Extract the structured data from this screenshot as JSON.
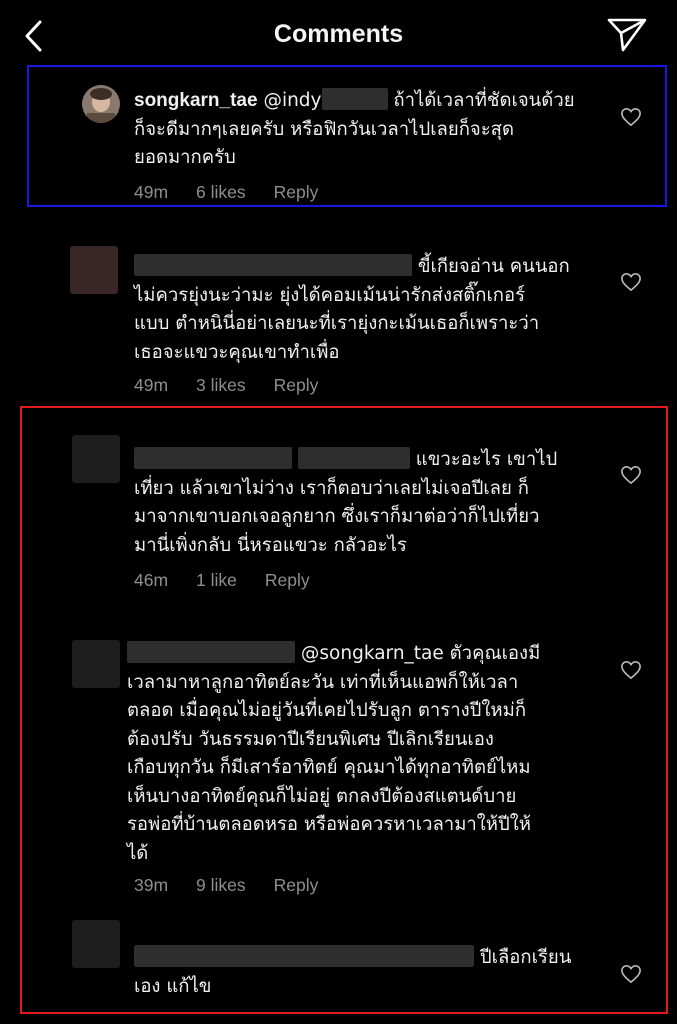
{
  "header": {
    "title": "Comments",
    "back_icon": "chevron-left-icon",
    "send_icon": "send-paper-plane-icon"
  },
  "comments": [
    {
      "username": "songkarn_tae",
      "mention": "@indy",
      "lines": [
        "ถ้าได้เวลาที่ชัดเจนด้วย",
        "ก็จะดีมากๆเลยครับ หรือฟิกวันเวลาไปเลยก็จะสุด",
        "ยอดมากครับ"
      ],
      "time": "49m",
      "likes": "6 likes",
      "reply": "Reply"
    },
    {
      "lines": [
        "ขี้เกียจอ่าน คนนอก",
        "ไม่ควรยุ่งนะว่ามะ ยุ่งได้คอมเม้นน่ารักส่งสติ๊กเกอร์",
        "แบบ ตำหนินี่อย่าเลยนะที่เรายุ่งกะเม้นเธอก็เพราะว่า",
        "เธอจะแขวะคุณเขาทำเพื่อ"
      ],
      "time": "49m",
      "likes": "3 likes",
      "reply": "Reply"
    },
    {
      "lines": [
        "แขวะอะไร เขาไป",
        "เที่ยว แล้วเขาไม่ว่าง เราก็ตอบว่าเลยไม่เจอปีเลย ก็",
        "มาจากเขาบอกเจอลูกยาก ซึ่งเราก็มาต่อว่าก็ไปเที่ยว",
        "มานี่เพิ่งกลับ นี่หรอแขวะ กลัวอะไร"
      ],
      "time": "46m",
      "likes": "1 like",
      "reply": "Reply"
    },
    {
      "mention": "@songkarn_tae",
      "lines": [
        "ตัวคุณเองมี",
        "เวลามาหาลูกอาทิตย์ละวัน เท่าที่เห็นแอพก็ให้เวลา",
        "ตลอด เมื่อคุณไม่อยู่วันที่เคยไปรับลูก ตารางปีใหม่ก็",
        "ต้องปรับ วันธรรมดาปีเรียนพิเศษ ปีเลิกเรียนเอง",
        "เกือบทุกวัน ก็มีเสาร์อาทิตย์ คุณมาได้ทุกอาทิตย์ไหม",
        "เห็นบางอาทิตย์คุณก็ไม่อยู่ ตกลงปีต้องสแตนด์บาย",
        "รอพ่อที่บ้านตลอดหรอ หรือพ่อควรหาเวลามาให้ปีให้",
        "ได้"
      ],
      "time": "39m",
      "likes": "9 likes",
      "reply": "Reply"
    },
    {
      "lines": [
        "ปีเลือกเรียน",
        "เอง  แก้ไข"
      ]
    }
  ]
}
